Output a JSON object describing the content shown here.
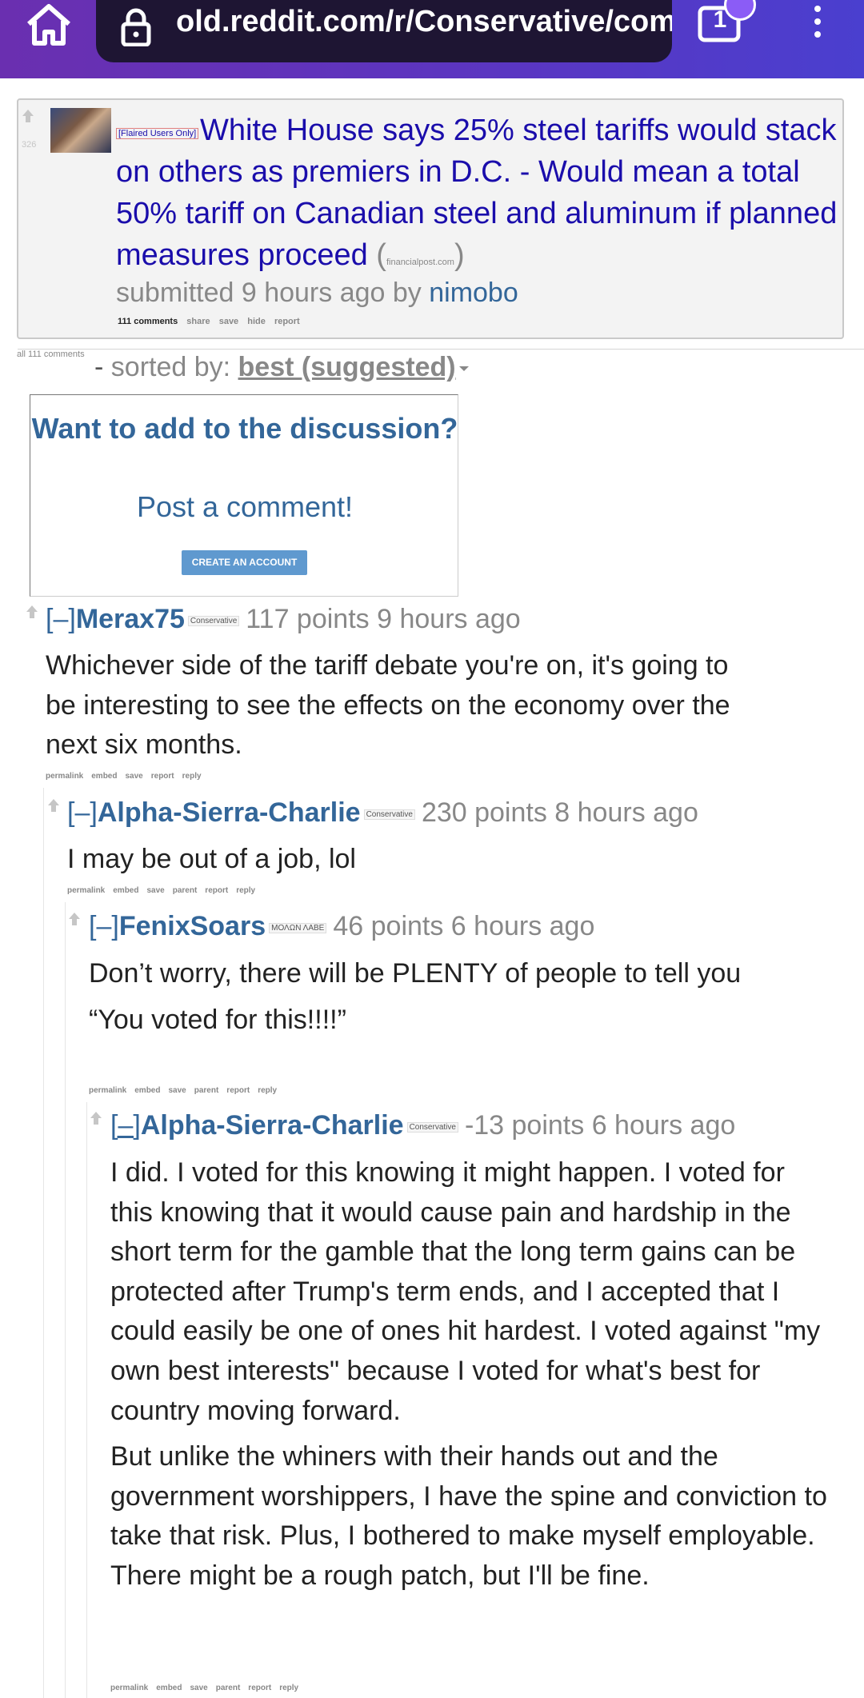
{
  "browser": {
    "url": "old.reddit.com/r/Conservative/comm",
    "tab_count": "1",
    "colors": {
      "bar": "#6a2fb0",
      "url_bg": "#1e1533"
    }
  },
  "post": {
    "score": "326",
    "flair": "[Flaired Users Only]",
    "title": "White House says 25% steel tariffs would stack on others as premiers in D.C. - Would mean a total 50% tariff on Canadian steel and aluminum if planned measures proceed",
    "domain": "financialpost.com",
    "paren_open": "(",
    "paren_close": ")",
    "submitted_prefix": "submitted 9 hours ago by ",
    "author": "nimobo",
    "buttons": {
      "comments": "111 comments",
      "share": "share",
      "save": "save",
      "hide": "hide",
      "report": "report"
    }
  },
  "comment_area": {
    "all_comments": "all 111 comments",
    "sort_prefix": "sorted by: ",
    "sort_selected": "best (suggested)"
  },
  "add_comment": {
    "title": "Want to add to the discussion?",
    "subtitle": "Post a comment!",
    "button": "CREATE AN ACCOUNT"
  },
  "comments": [
    {
      "expand": "[–]",
      "author": "Merax75",
      "flair": "Conservative",
      "meta": "117 points 9 hours ago",
      "body": [
        "Whichever side of the tariff debate you're on, it's going to be interesting to see the effects on the economy over the next six months."
      ],
      "buttons": [
        "permalink",
        "embed",
        "save",
        "report",
        "reply"
      ]
    },
    {
      "expand": "[–]",
      "author": "Alpha-Sierra-Charlie",
      "flair": "Conservative",
      "meta": "230 points 8 hours ago",
      "body": [
        "I may be out of a job, lol"
      ],
      "buttons": [
        "permalink",
        "embed",
        "save",
        "parent",
        "report",
        "reply"
      ]
    },
    {
      "expand": "[–]",
      "author": "FenixSoars",
      "flair": "ΜΟΛΩΝ ΛΑΒΕ",
      "meta": "46 points 6 hours ago",
      "body": [
        "Don’t worry, there will be PLENTY of people to tell you",
        "“You voted for this!!!!”"
      ],
      "buttons": [
        "permalink",
        "embed",
        "save",
        "parent",
        "report",
        "reply"
      ]
    },
    {
      "expand": "[–]",
      "author": "Alpha-Sierra-Charlie",
      "flair": "Conservative",
      "meta": "-13 points 6 hours ago",
      "body": [
        "I did. I voted for this knowing it might happen. I voted for this knowing that it would cause pain and hardship in the short term for the gamble that the long term gains can be protected after Trump's term ends, and I accepted that I could easily be one of ones hit hardest. I voted against \"my own best interests\" because I voted for what's best for country moving forward.",
        "But unlike the whiners with their hands out and the government worshippers, I have the spine and conviction to take that risk. Plus, I bothered to make myself employable. There might be a rough patch, but I'll be fine."
      ],
      "buttons": [
        "permalink",
        "embed",
        "save",
        "parent",
        "report",
        "reply"
      ]
    }
  ]
}
